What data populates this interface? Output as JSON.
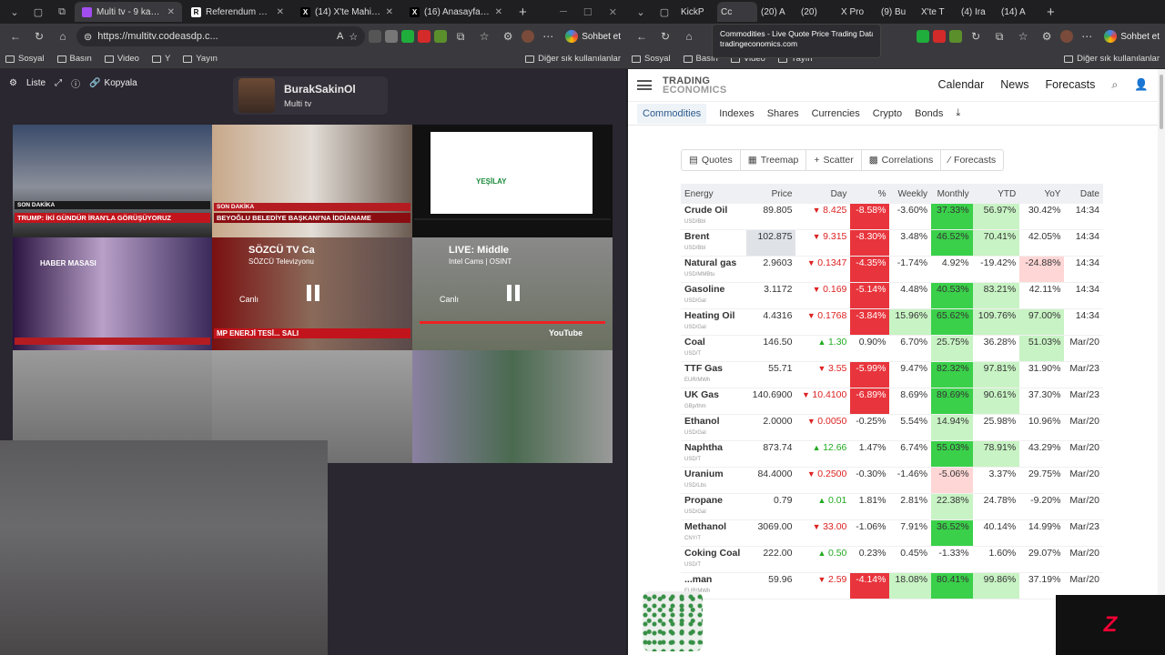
{
  "left": {
    "tabs": [
      {
        "title": "Multi tv - 9 kanal a",
        "active": true,
        "favcolor": "#a24df0"
      },
      {
        "title": "Referendum 2026, oggi",
        "active": false,
        "favcolor": "#ffffff",
        "favtext": "R"
      },
      {
        "title": "(14) X'te Mahir KILIÇ: \"C",
        "active": false,
        "favcolor": "#000000",
        "favtext": "X"
      },
      {
        "title": "(16) Anasayfa / X",
        "active": false,
        "favcolor": "#000000",
        "favtext": "X"
      }
    ],
    "url": "https://multitv.codeasdp.c...",
    "chat": "Sohbet et",
    "bookmarks": [
      "Sosyal",
      "Basın",
      "Video",
      "Y",
      "Yayın"
    ],
    "bookmarks_right": "Diğer sık kullanılanlar",
    "toolbar": {
      "list": "Liste",
      "copy": "Kopyala"
    },
    "profile": {
      "name": "BurakSakinOl",
      "sub": "Multi tv"
    },
    "cells": [
      {
        "caption": "TRUMP: İKİ GÜNDÜR İRAN'LA GÖRÜŞÜYORUZ",
        "sub": "SON DAKİKA"
      },
      {
        "caption": "BEYOĞLU BELEDİYE BAŞKANI'NA İDDİANAME",
        "sub": "SON DAKİKA"
      },
      {
        "caption": "YEŞİLAY",
        "sub": ""
      },
      {
        "caption": "HABER MASASI",
        "sub": ""
      },
      {
        "caption": "SÖZCÜ TV Ca",
        "sub": "SÖZCÜ Televizyonu"
      },
      {
        "caption": "LIVE: Middle",
        "sub": "Intel Cams | OSINT"
      },
      {
        "caption": "",
        "sub": ""
      },
      {
        "caption": "",
        "sub": ""
      },
      {
        "caption": "",
        "sub": ""
      }
    ],
    "live_label": "Canlı",
    "sozcu_ticker": "MP ENERJİ TESİ... SALI",
    "youtube": "YouTube"
  },
  "right": {
    "tabs": [
      "KickP",
      "Cc",
      "(20) A",
      "(20) ",
      "X Pro",
      "(9) Bu",
      "X'te T",
      "(4) Ira",
      "(14) A"
    ],
    "tooltip": {
      "title": "Commodities - Live Quote Price Trading Data",
      "domain": "tradingeconomics.com"
    },
    "chat": "Sohbet et",
    "bookmarks": [
      "Sosyal",
      "Basın",
      "Video",
      "Yayın"
    ],
    "bookmarks_right": "Diğer sık kullanılanlar",
    "logo": [
      "TRADING",
      "ECONOMICS"
    ],
    "nav": [
      "Calendar",
      "News",
      "Forecasts"
    ],
    "subnav": [
      "Commodities",
      "Indexes",
      "Shares",
      "Currencies",
      "Crypto",
      "Bonds"
    ],
    "tools": [
      "Quotes",
      "Treemap",
      "Scatter",
      "Correlations",
      "Forecasts"
    ],
    "columns": [
      "Energy",
      "Price",
      "Day",
      "%",
      "Weekly",
      "Monthly",
      "YTD",
      "YoY",
      "Date"
    ],
    "rows": [
      {
        "name": "Crude Oil",
        "unit": "USD/Bbl",
        "price": "89.805",
        "day": "8.425",
        "dir": "dn",
        "pct": "-8.58%",
        "weekly": "-3.60%",
        "monthly": "37.33%",
        "ytd": "56.97%",
        "yoy": "30.42%",
        "date": "14:34"
      },
      {
        "name": "Brent",
        "unit": "USD/Bbl",
        "price": "102.875",
        "day": "9.315",
        "dir": "dn",
        "pct": "-8.30%",
        "weekly": "3.48%",
        "monthly": "46.52%",
        "ytd": "70.41%",
        "yoy": "42.05%",
        "date": "14:34"
      },
      {
        "name": "Natural gas",
        "unit": "USD/MMBtu",
        "price": "2.9603",
        "day": "0.1347",
        "dir": "dn",
        "pct": "-4.35%",
        "weekly": "-1.74%",
        "monthly": "4.92%",
        "ytd": "-19.42%",
        "yoy": "-24.88%",
        "date": "14:34"
      },
      {
        "name": "Gasoline",
        "unit": "USD/Gal",
        "price": "3.1172",
        "day": "0.169",
        "dir": "dn",
        "pct": "-5.14%",
        "weekly": "4.48%",
        "monthly": "40.53%",
        "ytd": "83.21%",
        "yoy": "42.11%",
        "date": "14:34"
      },
      {
        "name": "Heating Oil",
        "unit": "USD/Gal",
        "price": "4.4316",
        "day": "0.1768",
        "dir": "dn",
        "pct": "-3.84%",
        "weekly": "15.96%",
        "monthly": "65.62%",
        "ytd": "109.76%",
        "yoy": "97.00%",
        "date": "14:34"
      },
      {
        "name": "Coal",
        "unit": "USD/T",
        "price": "146.50",
        "day": "1.30",
        "dir": "up",
        "pct": "0.90%",
        "weekly": "6.70%",
        "monthly": "25.75%",
        "ytd": "36.28%",
        "yoy": "51.03%",
        "date": "Mar/20"
      },
      {
        "name": "TTF Gas",
        "unit": "EUR/MWh",
        "price": "55.71",
        "day": "3.55",
        "dir": "dn",
        "pct": "-5.99%",
        "weekly": "9.47%",
        "monthly": "82.32%",
        "ytd": "97.81%",
        "yoy": "31.90%",
        "date": "Mar/23"
      },
      {
        "name": "UK Gas",
        "unit": "GBp/thm",
        "price": "140.6900",
        "day": "10.4100",
        "dir": "dn",
        "pct": "-6.89%",
        "weekly": "8.69%",
        "monthly": "89.69%",
        "ytd": "90.61%",
        "yoy": "37.30%",
        "date": "Mar/23"
      },
      {
        "name": "Ethanol",
        "unit": "USD/Gal",
        "price": "2.0000",
        "day": "0.0050",
        "dir": "dn",
        "pct": "-0.25%",
        "weekly": "5.54%",
        "monthly": "14.94%",
        "ytd": "25.98%",
        "yoy": "10.96%",
        "date": "Mar/20"
      },
      {
        "name": "Naphtha",
        "unit": "USD/T",
        "price": "873.74",
        "day": "12.66",
        "dir": "up",
        "pct": "1.47%",
        "weekly": "6.74%",
        "monthly": "55.03%",
        "ytd": "78.91%",
        "yoy": "43.29%",
        "date": "Mar/20"
      },
      {
        "name": "Uranium",
        "unit": "USD/Lbs",
        "price": "84.4000",
        "day": "0.2500",
        "dir": "dn",
        "pct": "-0.30%",
        "weekly": "-1.46%",
        "monthly": "-5.06%",
        "ytd": "3.37%",
        "yoy": "29.75%",
        "date": "Mar/20"
      },
      {
        "name": "Propane",
        "unit": "USD/Gal",
        "price": "0.79",
        "day": "0.01",
        "dir": "up",
        "pct": "1.81%",
        "weekly": "2.81%",
        "monthly": "22.38%",
        "ytd": "24.78%",
        "yoy": "-9.20%",
        "date": "Mar/20"
      },
      {
        "name": "Methanol",
        "unit": "CNY/T",
        "price": "3069.00",
        "day": "33.00",
        "dir": "dn",
        "pct": "-1.06%",
        "weekly": "7.91%",
        "monthly": "36.52%",
        "ytd": "40.14%",
        "yoy": "14.99%",
        "date": "Mar/23"
      },
      {
        "name": "Coking Coal",
        "unit": "USD/T",
        "price": "222.00",
        "day": "0.50",
        "dir": "up",
        "pct": "0.23%",
        "weekly": "0.45%",
        "monthly": "-1.33%",
        "ytd": "1.60%",
        "yoy": "29.07%",
        "date": "Mar/20"
      },
      {
        "name": "...man",
        "unit": "EUR/MWh",
        "price": "59.96",
        "day": "2.59",
        "dir": "dn",
        "pct": "-4.14%",
        "weekly": "18.08%",
        "monthly": "80.41%",
        "ytd": "99.86%",
        "yoy": "37.19%",
        "date": "Mar/20"
      }
    ]
  },
  "colors": {
    "neg_strong": "#e8343c",
    "neg_soft": "#ffd6d6",
    "pos_strong": "#3ad04a",
    "pos_soft": "#c8f3c4",
    "accent": "#2c5a8c"
  }
}
